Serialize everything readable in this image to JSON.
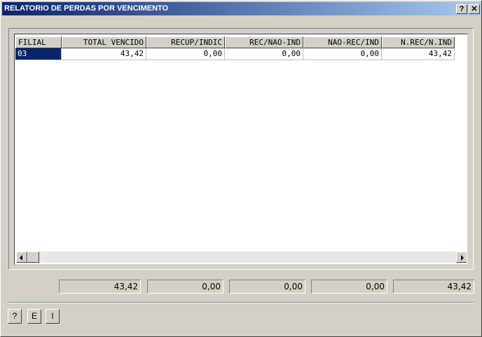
{
  "window": {
    "title": "RELATORIO DE PERDAS POR VENCIMENTO",
    "help_label": "?",
    "close_label": "✕"
  },
  "grid": {
    "columns": [
      "FILIAL",
      "TOTAL VENCIDO",
      "RECUP/INDIC",
      "REC/NAO-IND",
      "NAO-REC/IND",
      "N.REC/N.IND"
    ],
    "rows": [
      [
        "03",
        "43,42",
        "0,00",
        "0,00",
        "0,00",
        "43,42"
      ]
    ]
  },
  "totals": [
    "43,42",
    "0,00",
    "0,00",
    "0,00",
    "43,42"
  ],
  "buttons": {
    "help": "?",
    "e": "E",
    "i": "I"
  }
}
